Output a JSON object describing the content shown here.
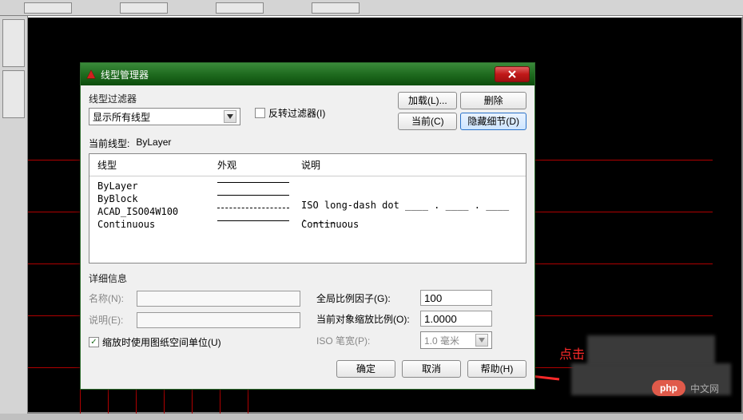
{
  "dialog": {
    "title": "线型管理器",
    "filter_label": "线型过滤器",
    "filter_dropdown": "显示所有线型",
    "invert_filter_label": "反转过滤器(I)",
    "load_btn": "加载(L)...",
    "delete_btn": "删除",
    "current_btn": "当前(C)",
    "hide_detail_btn": "隐藏细节(D)",
    "current_linetype_label": "当前线型:",
    "current_linetype_value": "ByLayer",
    "columns": {
      "name": "线型",
      "appearance": "外观",
      "description": "说明"
    },
    "rows": [
      {
        "name": "ByLayer",
        "desc": ""
      },
      {
        "name": "ByBlock",
        "desc": ""
      },
      {
        "name": "ACAD_ISO04W100",
        "desc": "ISO long-dash dot ____ . ____ . ____ . ____"
      },
      {
        "name": "Continuous",
        "desc": "Continuous"
      }
    ],
    "details": {
      "title": "详细信息",
      "name_label": "名称(N):",
      "desc_label": "说明(E):",
      "scale_checkbox": "缩放时使用图纸空间单位(U)",
      "global_scale_label": "全局比例因子(G):",
      "global_scale_value": "100",
      "object_scale_label": "当前对象缩放比例(O):",
      "object_scale_value": "1.0000",
      "iso_pen_label": "ISO 笔宽(P):",
      "iso_pen_value": "1.0 毫米"
    },
    "ok_btn": "确定",
    "cancel_btn": "取消",
    "help_btn": "帮助(H)"
  },
  "annotation": {
    "hint": "点击",
    "watermark": "中文网",
    "php": "php"
  }
}
